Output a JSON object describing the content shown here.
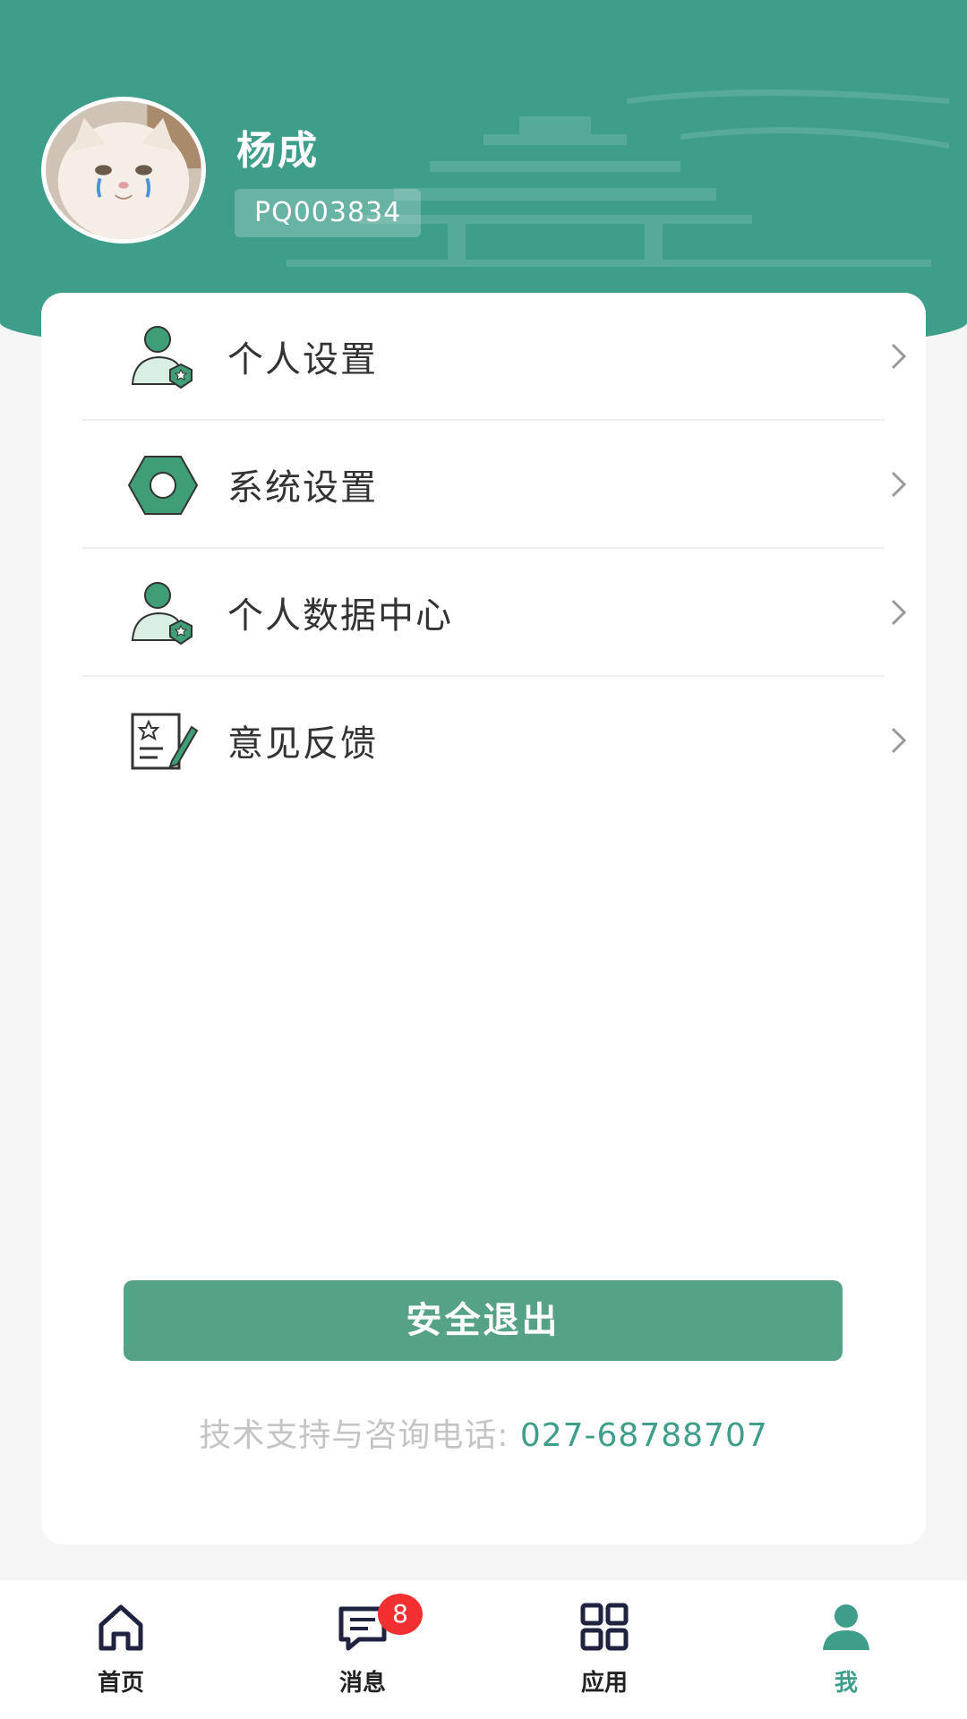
{
  "profile": {
    "name": "杨成",
    "employee_id": "PQ003834"
  },
  "menu": [
    {
      "label": "个人设置",
      "icon": "user-shield-icon"
    },
    {
      "label": "系统设置",
      "icon": "hex-nut-icon"
    },
    {
      "label": "个人数据中心",
      "icon": "user-shield-icon"
    },
    {
      "label": "意见反馈",
      "icon": "feedback-edit-icon"
    }
  ],
  "logout_label": "安全退出",
  "support": {
    "label": "技术支持与咨询电话: ",
    "phone": "027-68788707"
  },
  "nav": [
    {
      "label": "首页",
      "icon": "home-icon"
    },
    {
      "label": "消息",
      "icon": "message-icon",
      "badge": "8"
    },
    {
      "label": "应用",
      "icon": "apps-grid-icon"
    },
    {
      "label": "我",
      "icon": "person-icon",
      "active": true
    }
  ],
  "colors": {
    "primary": "#3e9e8a",
    "button": "#56a286",
    "badge": "#f23030",
    "icon_green": "#3f9e75"
  }
}
